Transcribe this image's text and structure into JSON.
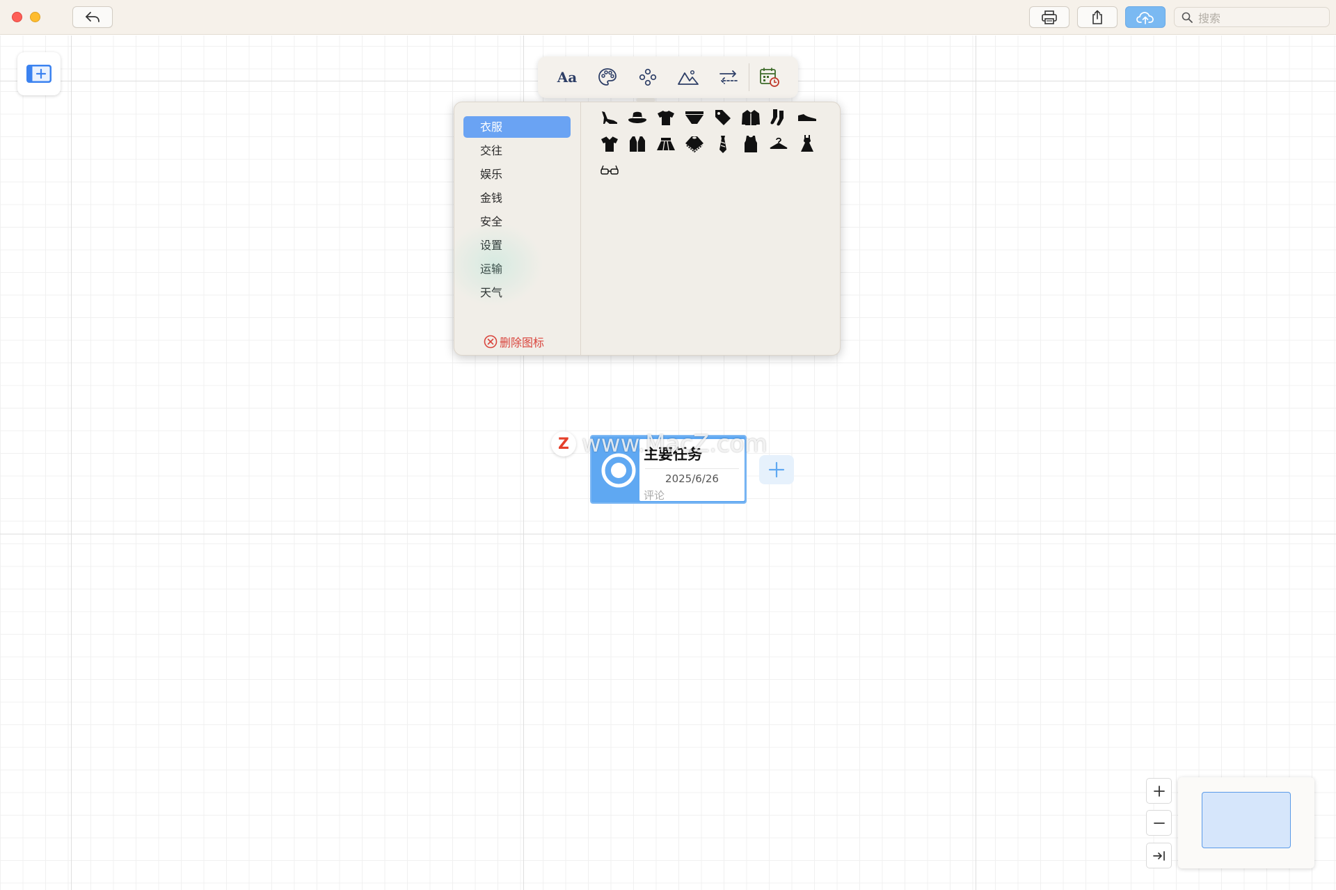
{
  "titlebar": {
    "search_placeholder": "搜索",
    "buttons": [
      "back-icon",
      "print-icon",
      "share-icon",
      "cloud-upload-icon"
    ]
  },
  "toolbar": {
    "font_tool_label": "Aa",
    "tools": [
      "text-style",
      "palette-icon",
      "icon-picker-icon",
      "image-icon",
      "links-icon",
      "calendar-icon"
    ]
  },
  "icon_picker": {
    "categories": [
      {
        "label": "衣服",
        "selected": true
      },
      {
        "label": "交往",
        "selected": false
      },
      {
        "label": "娱乐",
        "selected": false
      },
      {
        "label": "金钱",
        "selected": false
      },
      {
        "label": "安全",
        "selected": false
      },
      {
        "label": "设置",
        "selected": false
      },
      {
        "label": "运输",
        "selected": false
      },
      {
        "label": "天气",
        "selected": false
      }
    ],
    "delete_label": "删除图标",
    "icons": [
      "high-heel-icon",
      "hat-icon",
      "tshirt-icon",
      "underwear-icon",
      "price-tag-icon",
      "jacket-icon",
      "socks-icon",
      "sneaker-icon",
      "shirt-icon",
      "vest-icon",
      "skirt-icon",
      "poncho-icon",
      "tie-icon",
      "tank-top-icon",
      "hanger-icon",
      "dress-icon",
      "glasses-icon"
    ]
  },
  "node": {
    "title": "主要任务",
    "date": "2025/6/26",
    "comment_placeholder": "评论"
  },
  "watermark": {
    "badge": "Z",
    "text": "www.MacZ.com"
  },
  "colors": {
    "accent": "#6aa3f3",
    "node_blue": "#5fa8f2",
    "delete_red": "#d9453d",
    "titlebar_bg": "#f6f1ea"
  }
}
